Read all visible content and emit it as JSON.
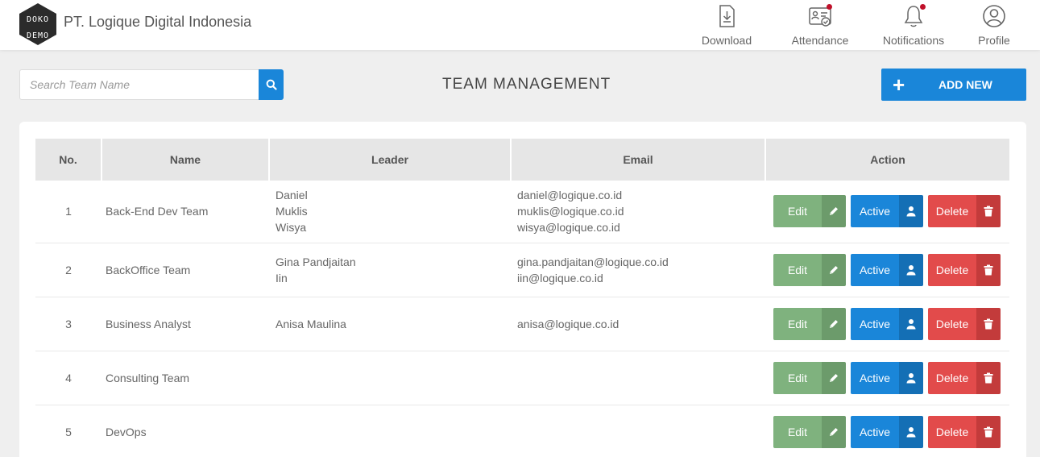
{
  "header": {
    "logo_text": [
      "DOKO",
      "DEMO"
    ],
    "company": "PT. Logique Digital Indonesia",
    "nav": [
      {
        "label": "Download",
        "icon": "download-icon",
        "badge": false
      },
      {
        "label": "Attendance",
        "icon": "attendance-icon",
        "badge": true
      },
      {
        "label": "Notifications",
        "icon": "bell-icon",
        "badge": true
      },
      {
        "label": "Profile",
        "icon": "user-circle-icon",
        "badge": false
      }
    ]
  },
  "toolbar": {
    "search_placeholder": "Search Team Name",
    "search_value": "",
    "title": "TEAM MANAGEMENT",
    "add_label": "ADD NEW"
  },
  "table": {
    "columns": [
      "No.",
      "Name",
      "Leader",
      "Email",
      "Action"
    ],
    "action_labels": {
      "edit": "Edit",
      "active": "Active",
      "delete": "Delete"
    },
    "rows": [
      {
        "no": "1",
        "name": "Back-End Dev Team",
        "leaders": [
          "Daniel",
          "Muklis",
          "Wisya"
        ],
        "emails": [
          "daniel@logique.co.id",
          "muklis@logique.co.id",
          "wisya@logique.co.id"
        ]
      },
      {
        "no": "2",
        "name": "BackOffice Team",
        "leaders": [
          "Gina Pandjaitan",
          "Iin"
        ],
        "emails": [
          "gina.pandjaitan@logique.co.id",
          "iin@logique.co.id"
        ]
      },
      {
        "no": "3",
        "name": "Business Analyst",
        "leaders": [
          "Anisa Maulina"
        ],
        "emails": [
          "anisa@logique.co.id"
        ]
      },
      {
        "no": "4",
        "name": "Consulting Team",
        "leaders": [],
        "emails": []
      },
      {
        "no": "5",
        "name": "DevOps",
        "leaders": [],
        "emails": []
      }
    ]
  },
  "colors": {
    "primary": "#1a86d9",
    "edit": "#7fb27e",
    "delete": "#e24b4b",
    "badge": "#c0102a"
  }
}
